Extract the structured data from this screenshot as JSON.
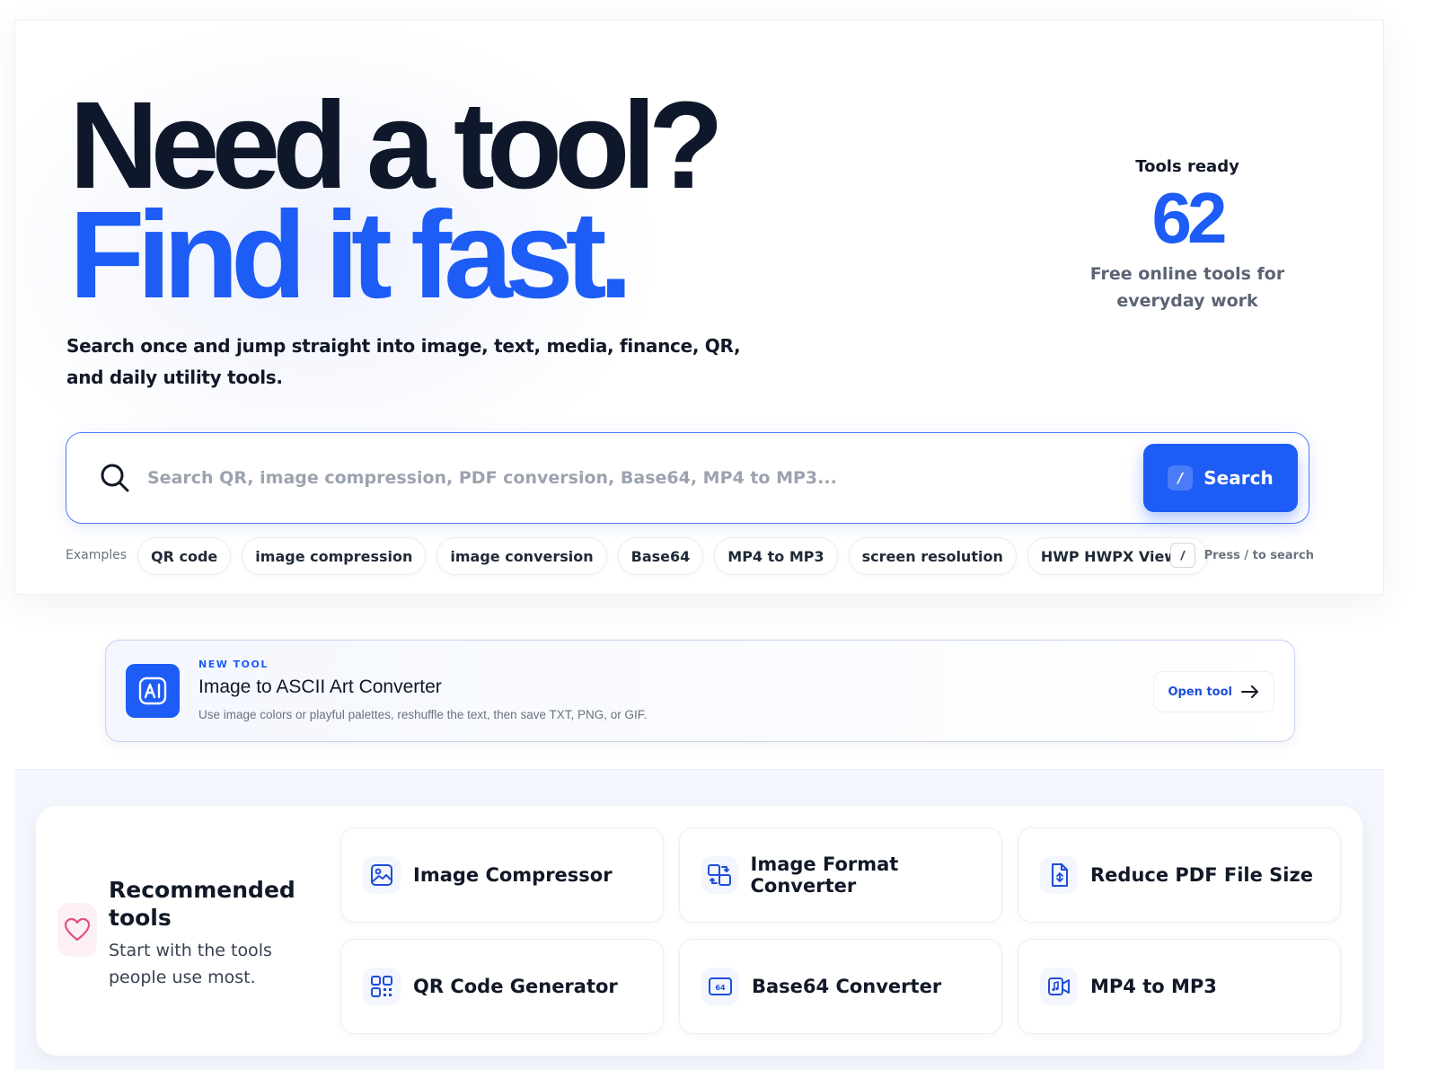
{
  "hero": {
    "headline_line1": "Need a tool?",
    "headline_line2": "Find it fast.",
    "lead": "Search once and jump straight into image, text, media, finance, QR, and daily utility tools.",
    "stat": {
      "label": "Tools ready",
      "value": "62",
      "sub": "Free online tools for everyday work"
    }
  },
  "search": {
    "placeholder": "Search QR, image compression, PDF conversion, Base64, MP4 to MP3...",
    "button_shortcut": "/",
    "button_label": "Search",
    "icon": "search-icon"
  },
  "examples": {
    "label": "Examples",
    "chips": [
      "QR code",
      "image compression",
      "image conversion",
      "Base64",
      "MP4 to MP3",
      "screen resolution",
      "HWP HWPX Viewer"
    ],
    "shortcut_key": "/",
    "shortcut_hint": "Press / to search"
  },
  "new_tool": {
    "eyebrow": "NEW TOOL",
    "title": "Image to ASCII Art Converter",
    "description": "Use image colors or playful palettes, reshuffle the text, then save TXT, PNG, or GIF.",
    "button_label": "Open tool",
    "icon": "ai-badge-icon"
  },
  "recommended": {
    "title": "Recommended tools",
    "subtitle": "Start with the tools people use most.",
    "icon": "heart-icon",
    "tools": [
      {
        "label": "Image Compressor",
        "icon": "image-icon"
      },
      {
        "label": "Image Format Converter",
        "icon": "convert-icon"
      },
      {
        "label": "Reduce PDF File Size",
        "icon": "pdf-file-icon"
      },
      {
        "label": "QR Code Generator",
        "icon": "qr-code-icon"
      },
      {
        "label": "Base64 Converter",
        "icon": "base64-icon"
      },
      {
        "label": "MP4 to MP3",
        "icon": "video-audio-icon"
      }
    ]
  },
  "colors": {
    "accent": "#1d5cf5",
    "heading": "#0f172a",
    "muted": "#6b7280",
    "heart": "#e0527a"
  }
}
